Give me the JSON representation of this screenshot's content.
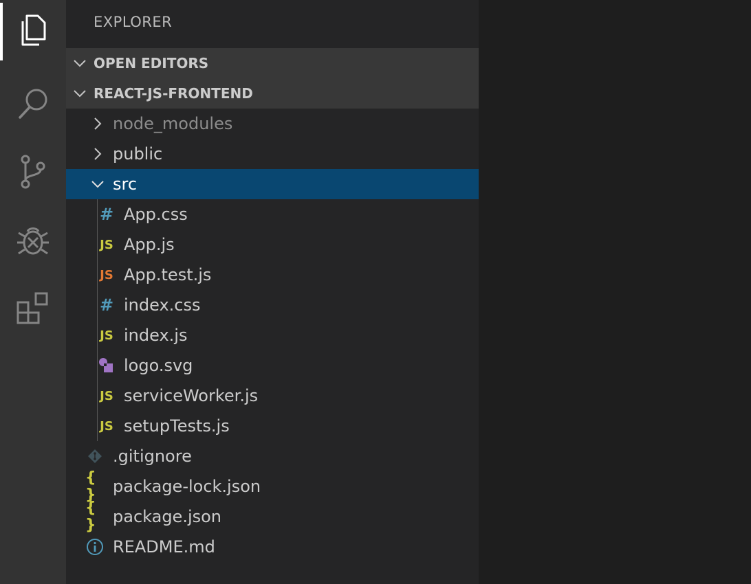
{
  "activity_bar": {
    "items": [
      {
        "icon": "files-icon",
        "active": true
      },
      {
        "icon": "search-icon",
        "active": false
      },
      {
        "icon": "source-control-icon",
        "active": false
      },
      {
        "icon": "debug-icon",
        "active": false
      },
      {
        "icon": "extensions-icon",
        "active": false
      }
    ]
  },
  "explorer": {
    "title": "EXPLORER",
    "open_editors": "OPEN EDITORS",
    "project": "REACT-JS-FRONTEND",
    "tree": {
      "node_modules": "node_modules",
      "public": "public",
      "src": "src",
      "app_css": "App.css",
      "app_js": "App.js",
      "app_test_js": "App.test.js",
      "index_css": "index.css",
      "index_js": "index.js",
      "logo_svg": "logo.svg",
      "service_worker_js": "serviceWorker.js",
      "setup_tests_js": "setupTests.js",
      "gitignore": ".gitignore",
      "package_lock_json": "package-lock.json",
      "package_json": "package.json",
      "readme_md": "README.md"
    },
    "icon_glyphs": {
      "js": "JS",
      "hash": "#",
      "json": "{ }"
    }
  },
  "colors": {
    "selection": "#094771",
    "js": "#cbcb41",
    "js_test": "#e37933",
    "css": "#519aba",
    "svg": "#a074c4"
  }
}
